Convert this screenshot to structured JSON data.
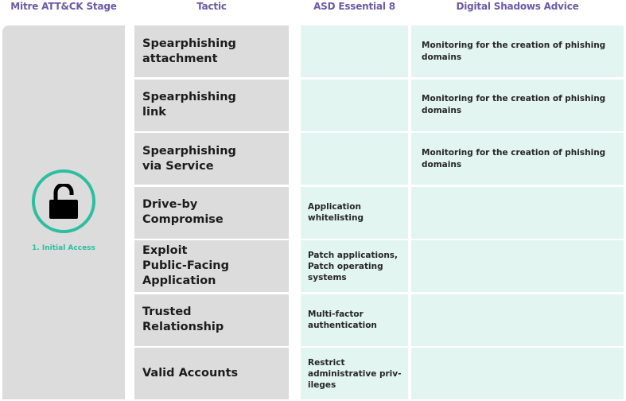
{
  "headers": {
    "stage": "Mitre ATT&CK Stage",
    "tactic": "Tactic",
    "asd": "ASD Essential 8",
    "advice": "Digital Shadows Advice"
  },
  "stage": {
    "label": "1. Initial Access",
    "icon": "unlocked-padlock-icon",
    "accent_color": "#2bbf9f"
  },
  "colors": {
    "header_text": "#6b5aa6",
    "tactic_bg": "#dcdcdc",
    "mitigation_bg": "#e2f5f1"
  },
  "rows": [
    {
      "tactic": "Spearphishing\nattachment",
      "asd": "",
      "advice": "Monitoring for the creation of phishing\ndomains"
    },
    {
      "tactic": "Spearphishing\nlink",
      "asd": "",
      "advice": "Monitoring for the creation of phishing\ndomains"
    },
    {
      "tactic": "Spearphishing\nvia Service",
      "asd": "",
      "advice": "Monitoring for the creation of phishing\ndomains"
    },
    {
      "tactic": "Drive-by\nCompromise",
      "asd": "Application\nwhitelisting",
      "advice": ""
    },
    {
      "tactic": "Exploit\nPublic-Facing\nApplication",
      "asd": "Patch applications,\nPatch operating\nsystems",
      "advice": ""
    },
    {
      "tactic": "Trusted\nRelationship",
      "asd": "Multi-factor\nauthentication",
      "advice": ""
    },
    {
      "tactic": "Valid Accounts",
      "asd": "Restrict\nadministrative priv-\nileges",
      "advice": ""
    }
  ]
}
